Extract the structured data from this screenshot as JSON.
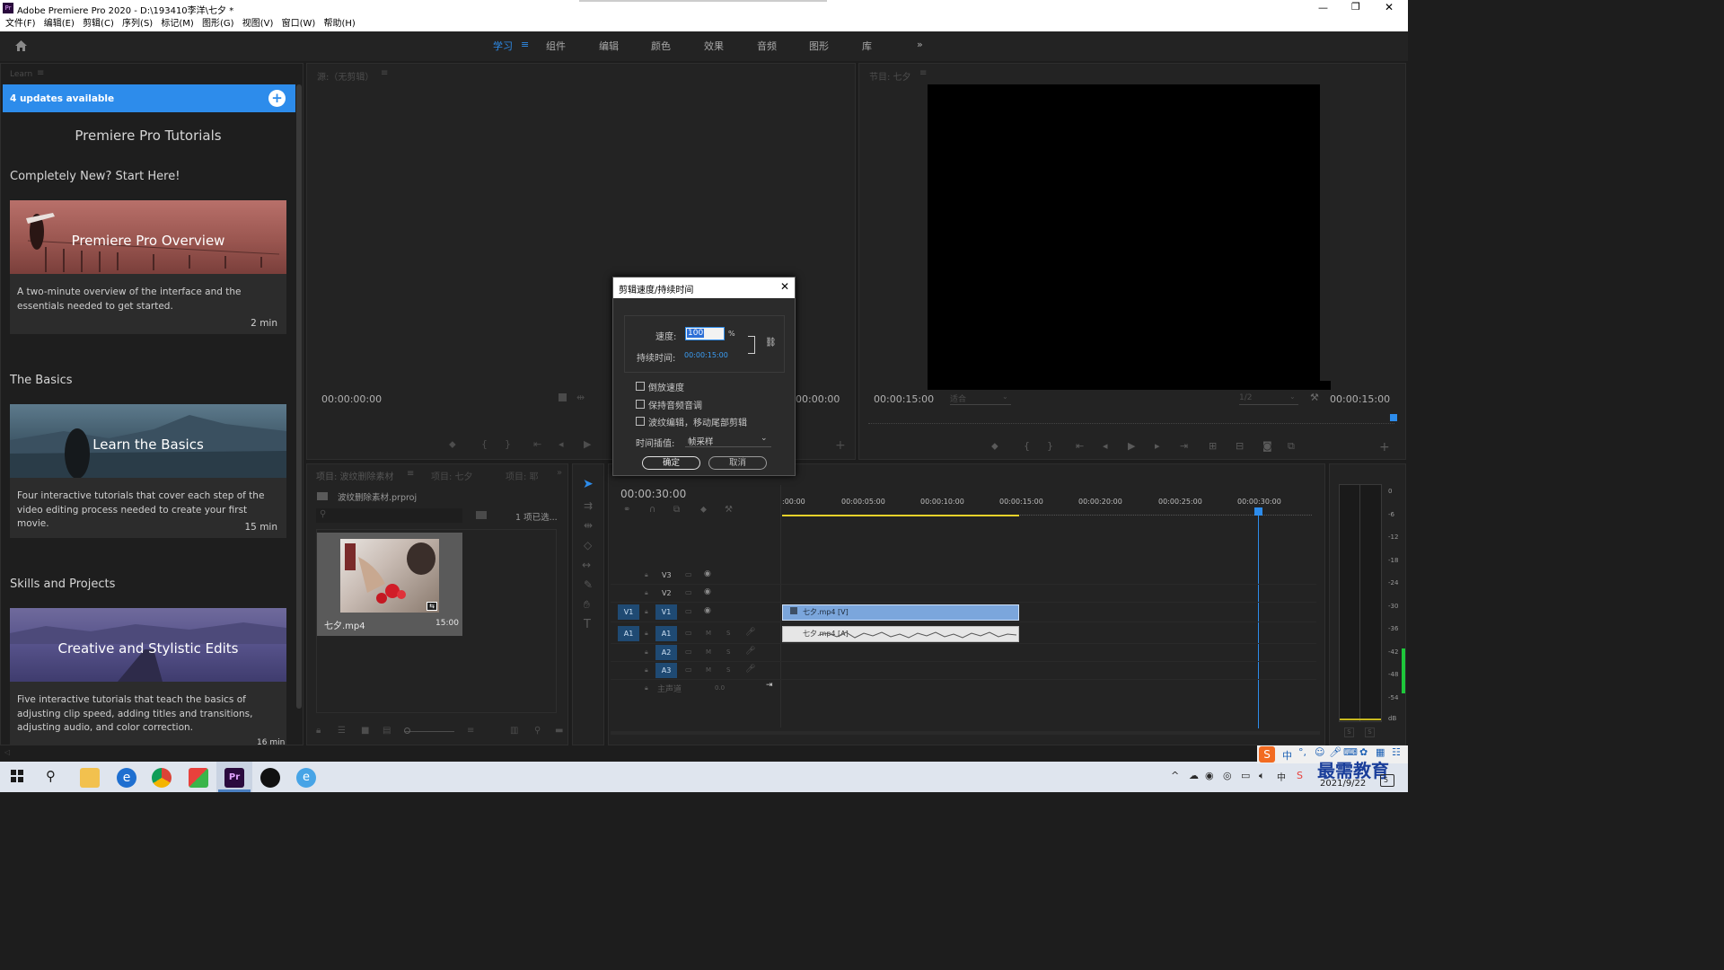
{
  "window": {
    "title": "Adobe Premiere Pro 2020 - D:\\193410李洋\\七夕 *",
    "controls": [
      "—",
      "❐",
      "✕"
    ]
  },
  "menu": [
    "文件(F)",
    "编辑(E)",
    "剪辑(C)",
    "序列(S)",
    "标记(M)",
    "图形(G)",
    "视图(V)",
    "窗口(W)",
    "帮助(H)"
  ],
  "workspaces": [
    "学习",
    "组件",
    "编辑",
    "颜色",
    "效果",
    "音频",
    "图形",
    "库"
  ],
  "workspace_more": "»",
  "learn": {
    "panel_label": "Learn",
    "updates_banner": "4 updates available",
    "heading": "Premiere Pro Tutorials",
    "sections": [
      {
        "title": "Completely New? Start Here!",
        "card": {
          "title": "Premiere Pro Overview",
          "desc": "A two-minute overview of the interface and the essentials needed to get started.",
          "duration": "2 min"
        }
      },
      {
        "title": "The Basics",
        "card": {
          "title": "Learn the Basics",
          "desc": "Four interactive tutorials that cover each step of the video editing process needed to create your first movie.",
          "duration": "15 min"
        }
      },
      {
        "title": "Skills and Projects",
        "card": {
          "title": "Creative and Stylistic Edits",
          "desc": "Five interactive tutorials that teach the basics of adjusting clip speed, adding titles and transitions, adjusting audio, and color correction.",
          "duration": "16 min"
        }
      }
    ]
  },
  "source": {
    "label": "源:（无剪辑）",
    "timecode_left": "00:00:00:00",
    "timecode_right": "00:00:00"
  },
  "program": {
    "label": "节目: 七夕",
    "timecode_left": "00:00:15:00",
    "fit": "适合",
    "resolution": "1/2",
    "timecode_right": "00:00:15:00"
  },
  "project": {
    "tabs": [
      "项目: 波纹删除素材",
      "项目: 七夕",
      "项目: 耶"
    ],
    "file": "波纹删除素材.prproj",
    "selection": "1 项已选...",
    "clip_name": "七夕.mp4",
    "clip_duration": "15:00"
  },
  "timeline": {
    "timecode": "00:00:30:00",
    "ruler": [
      ":00:00",
      "00:00:05:00",
      "00:00:10:00",
      "00:00:15:00",
      "00:00:20:00",
      "00:00:25:00",
      "00:00:30:00"
    ],
    "video_tracks": [
      "V3",
      "V2",
      "V1"
    ],
    "audio_tracks": [
      "A1",
      "A2",
      "A3"
    ],
    "source_v": "V1",
    "source_a": "A1",
    "master": "主声道",
    "master_value": "0.0",
    "video_clip": "七夕.mp4 [V]",
    "audio_clip": "七夕.mp4 [A]",
    "mute": "M",
    "solo": "S"
  },
  "meter": {
    "scale": [
      "0",
      "-6",
      "-12",
      "-18",
      "-24",
      "-30",
      "-36",
      "-42",
      "-48",
      "-54",
      "dB"
    ],
    "buttons": [
      "S",
      "S"
    ]
  },
  "dialog": {
    "title": "剪辑速度/持续时间",
    "speed_label": "速度:",
    "speed_value": "100",
    "speed_unit": "%",
    "duration_label": "持续时间:",
    "duration_value": "00:00:15:00",
    "reverse": "倒放速度",
    "keep_pitch": "保持音频音调",
    "ripple": "波纹编辑，移动尾部剪辑",
    "interp_label": "时间插值:",
    "interp_value": "帧采样",
    "ok": "确定",
    "cancel": "取消"
  },
  "taskbar": {
    "date": "2021/9/22",
    "ime": "中",
    "watermark": "最需教育",
    "badge": "5"
  }
}
